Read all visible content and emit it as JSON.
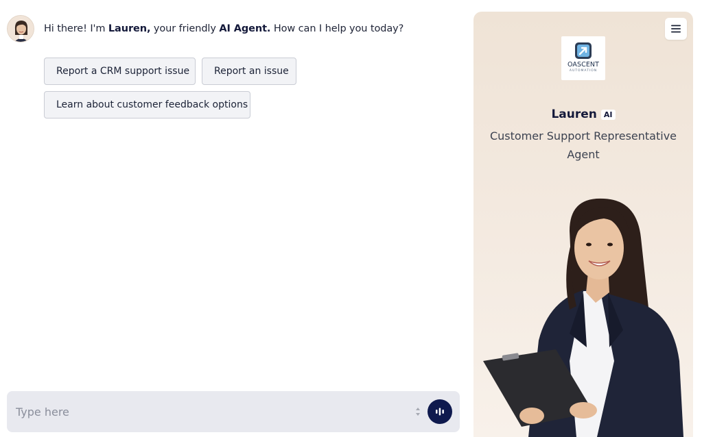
{
  "chat": {
    "greeting": {
      "prefix": "Hi there! I'm ",
      "name": "Lauren,",
      "middle": " your friendly ",
      "role": "AI Agent.",
      "suffix": " How can I help you today?"
    },
    "quick_replies": [
      "Report a CRM support issue",
      "Report an issue",
      "Learn about customer feedback options"
    ],
    "composer": {
      "placeholder": "Type here",
      "value": ""
    }
  },
  "panel": {
    "logo": {
      "word": "OASCENT",
      "sub": "AUTOMATION"
    },
    "agent_name": "Lauren",
    "badge": "AI",
    "agent_role": "Customer Support Representative Agent",
    "icons": {
      "menu": "hamburger-menu-icon",
      "voice": "voice-wave-icon",
      "resize": "resize-arrows-icon"
    },
    "colors": {
      "accent": "#0f1a4e",
      "panel_bg": "#f3e9df",
      "composer_bg": "#e8e9ef"
    }
  }
}
